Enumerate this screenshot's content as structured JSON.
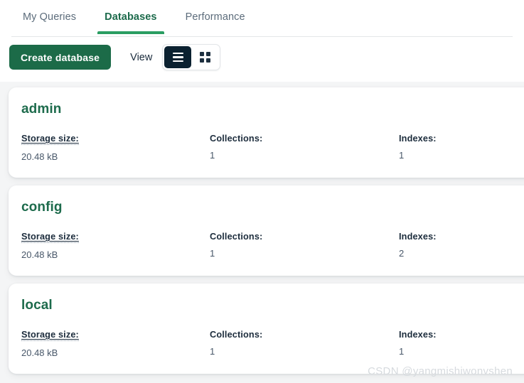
{
  "tabs": [
    {
      "label": "My Queries",
      "active": false
    },
    {
      "label": "Databases",
      "active": true
    },
    {
      "label": "Performance",
      "active": false
    }
  ],
  "toolbar": {
    "create_label": "Create database",
    "view_label": "View",
    "list_view_icon": "list-view-icon",
    "grid_view_icon": "grid-view-icon",
    "active_view": "list"
  },
  "labels": {
    "storage": "Storage size:",
    "collections": "Collections:",
    "indexes": "Indexes:"
  },
  "databases": [
    {
      "name": "admin",
      "storage_size": "20.48 kB",
      "collections": "1",
      "indexes": "1"
    },
    {
      "name": "config",
      "storage_size": "20.48 kB",
      "collections": "1",
      "indexes": "2"
    },
    {
      "name": "local",
      "storage_size": "20.48 kB",
      "collections": "1",
      "indexes": "1"
    }
  ],
  "watermark": "CSDN @yangmishiwonvshen",
  "colors": {
    "brand_green": "#1c6b48",
    "tab_active_underline": "#2a9d62",
    "toggle_active_bg": "#0b2130",
    "page_bg": "#f4f5f6"
  }
}
